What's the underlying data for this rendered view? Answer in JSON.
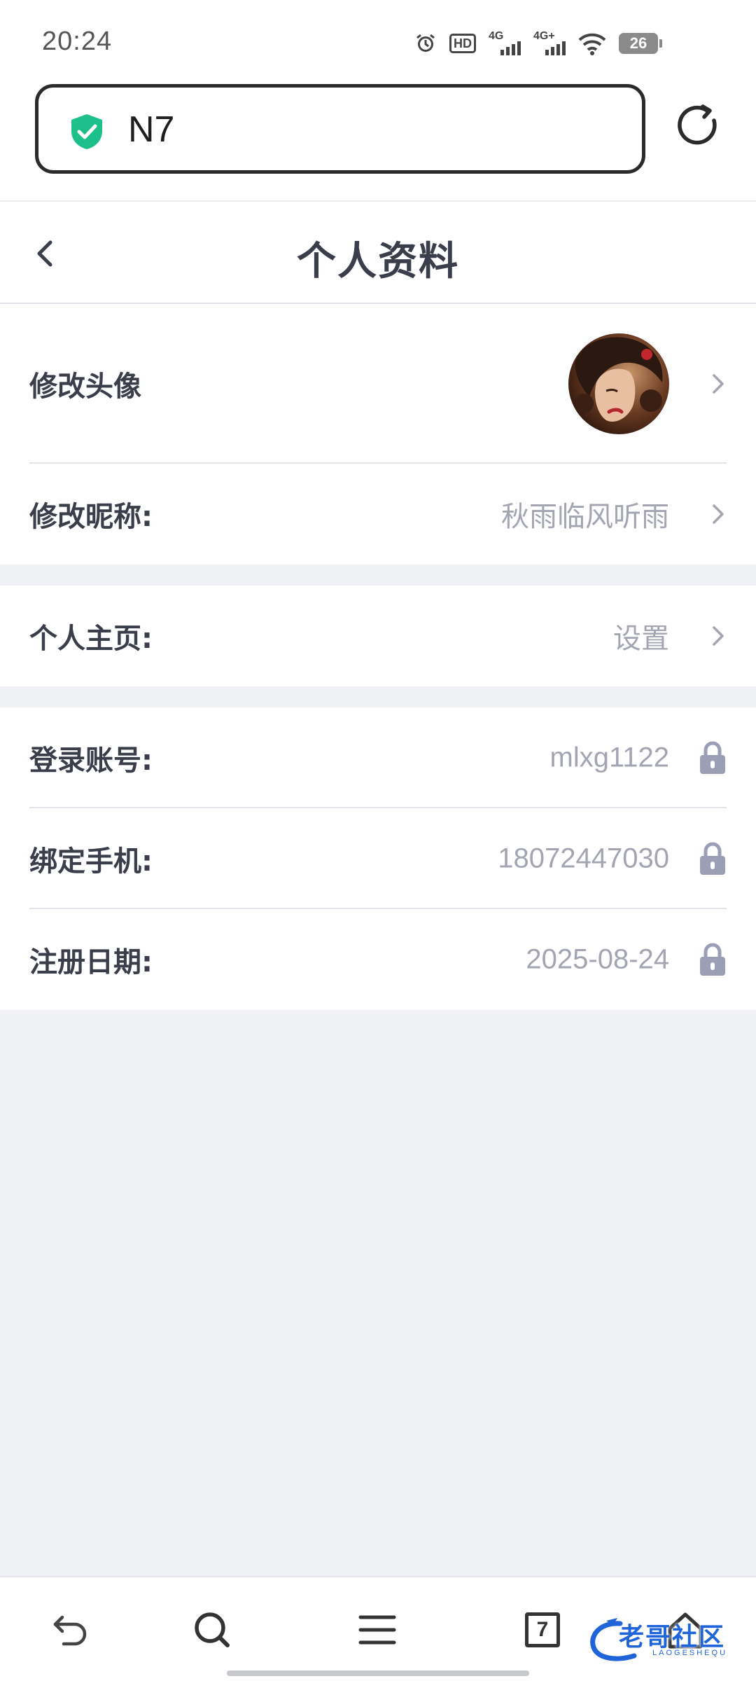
{
  "status_bar": {
    "time": "20:24",
    "hd_label": "HD",
    "net1_label": "4G",
    "net2_label": "4G+",
    "battery": "26"
  },
  "browser": {
    "url": "N7",
    "secure_color": "#1dbf8a"
  },
  "header": {
    "title": "个人资料"
  },
  "profile": {
    "avatar_label": "修改头像",
    "nickname_label": "修改昵称:",
    "nickname_value": "秋雨临风听雨",
    "homepage_label": "个人主页:",
    "homepage_value": "设置",
    "account_label": "登录账号:",
    "account_value": "mlxg1122",
    "phone_label": "绑定手机:",
    "phone_value": "18072447030",
    "register_label": "注册日期:",
    "register_value": "2025-08-24"
  },
  "bottom_nav": {
    "tab_count": "7"
  },
  "watermark": {
    "text": "老哥社区",
    "sub": "LAOGESHEQU"
  },
  "colors": {
    "label": "#3a3d4a",
    "value": "#a3a6b2",
    "lock": "#9a9fb5",
    "background": "#f0f1f5"
  }
}
